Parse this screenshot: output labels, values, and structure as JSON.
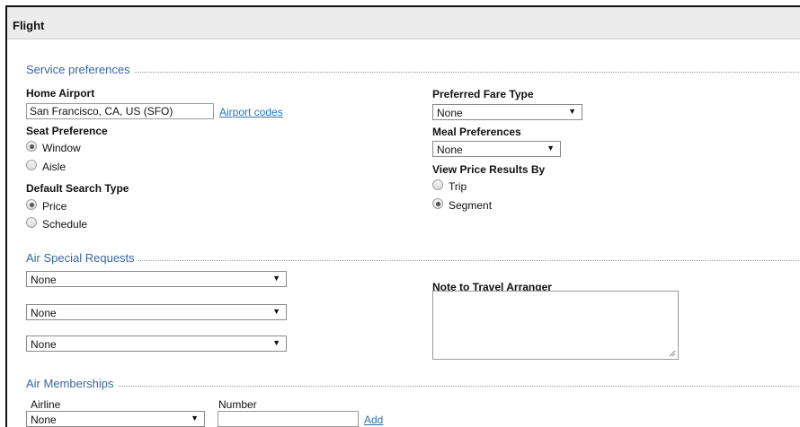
{
  "header": {
    "title": "Flight"
  },
  "service_preferences": {
    "section_title": "Service preferences",
    "home_airport": {
      "label": "Home Airport",
      "value": "San Francisco, CA, US (SFO)",
      "link": "Airport codes"
    },
    "seat_preference": {
      "label": "Seat Preference",
      "options": [
        "Window",
        "Aisle"
      ],
      "selected": "Window"
    },
    "default_search_type": {
      "label": "Default Search Type",
      "options": [
        "Price",
        "Schedule"
      ],
      "selected": "Price"
    },
    "preferred_fare_type": {
      "label": "Preferred Fare Type",
      "value": "None"
    },
    "meal_preferences": {
      "label": "Meal Preferences",
      "value": "None"
    },
    "view_price_results_by": {
      "label": "View Price Results By",
      "options": [
        "Trip",
        "Segment"
      ],
      "selected": "Segment"
    }
  },
  "air_special_requests": {
    "section_title": "Air Special Requests",
    "requests": [
      "None",
      "None",
      "None"
    ],
    "note_label": "Note to Travel Arranger",
    "note_value": ""
  },
  "air_memberships": {
    "section_title": "Air Memberships",
    "airline_label": "Airline",
    "airline_value": "None",
    "number_label": "Number",
    "number_value": "",
    "add_link": "Add"
  },
  "icons": {
    "caret": "▼"
  }
}
